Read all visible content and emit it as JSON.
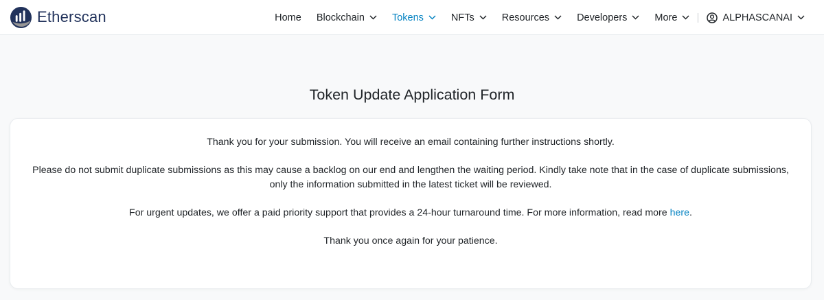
{
  "header": {
    "brand_name": "Etherscan",
    "brand_icon": "etherscan-logo-icon",
    "nav": [
      {
        "label": "Home",
        "has_dropdown": false,
        "active": false
      },
      {
        "label": "Blockchain",
        "has_dropdown": true,
        "active": false
      },
      {
        "label": "Tokens",
        "has_dropdown": true,
        "active": true
      },
      {
        "label": "NFTs",
        "has_dropdown": true,
        "active": false
      },
      {
        "label": "Resources",
        "has_dropdown": true,
        "active": false
      },
      {
        "label": "Developers",
        "has_dropdown": true,
        "active": false
      },
      {
        "label": "More",
        "has_dropdown": true,
        "active": false
      }
    ],
    "user": {
      "label": "ALPHASCANAI",
      "icon": "user-circle-icon"
    }
  },
  "main": {
    "title": "Token Update Application Form",
    "messages": {
      "thank_you": "Thank you for your submission. You will receive an email containing further instructions shortly.",
      "duplicate_warning": "Please do not submit duplicate submissions as this may cause a backlog on our end and lengthen the waiting period. Kindly take note that in the case of duplicate submissions, only the information submitted in the latest ticket will be reviewed.",
      "urgent_prefix": "For urgent updates, we offer a paid priority support that provides a 24-hour turnaround time. For more information, read more ",
      "urgent_link": "here",
      "urgent_suffix": ".",
      "patience": "Thank you once again for your patience."
    }
  },
  "colors": {
    "brand_dark": "#21325b",
    "accent_link": "#0784c3",
    "page_background": "#f8f9fa",
    "card_background": "#ffffff"
  }
}
